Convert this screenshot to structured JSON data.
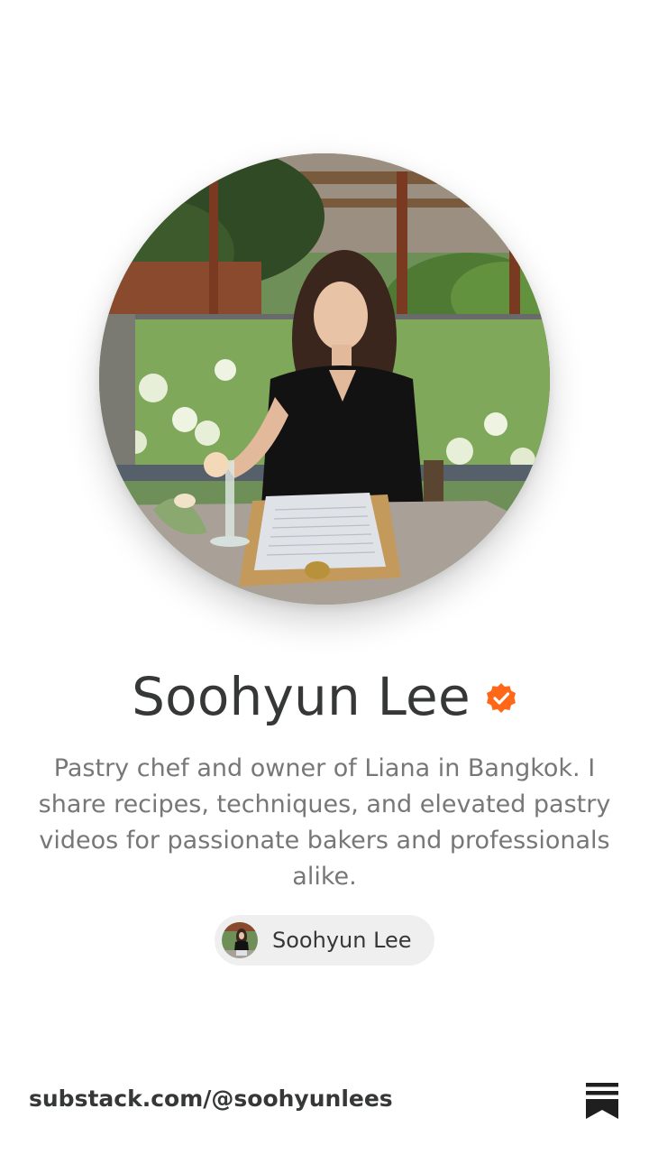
{
  "profile": {
    "name": "Soohyun Lee",
    "verified": true,
    "bio": "Pastry chef and owner of Liana in Bangkok. I share recipes, techniques, and elevated pastry videos for passionate bakers and professionals alike.",
    "avatar_icon": "profile-photo",
    "verified_icon": "verified-check-icon"
  },
  "chip": {
    "label": "Soohyun Lee"
  },
  "footer": {
    "url": "substack.com/@soohyunlees",
    "logo_icon": "substack-logo-icon"
  },
  "colors": {
    "accent": "#FF6719",
    "text": "#363737",
    "muted": "#777777",
    "chip_bg": "#EFEFEF"
  }
}
